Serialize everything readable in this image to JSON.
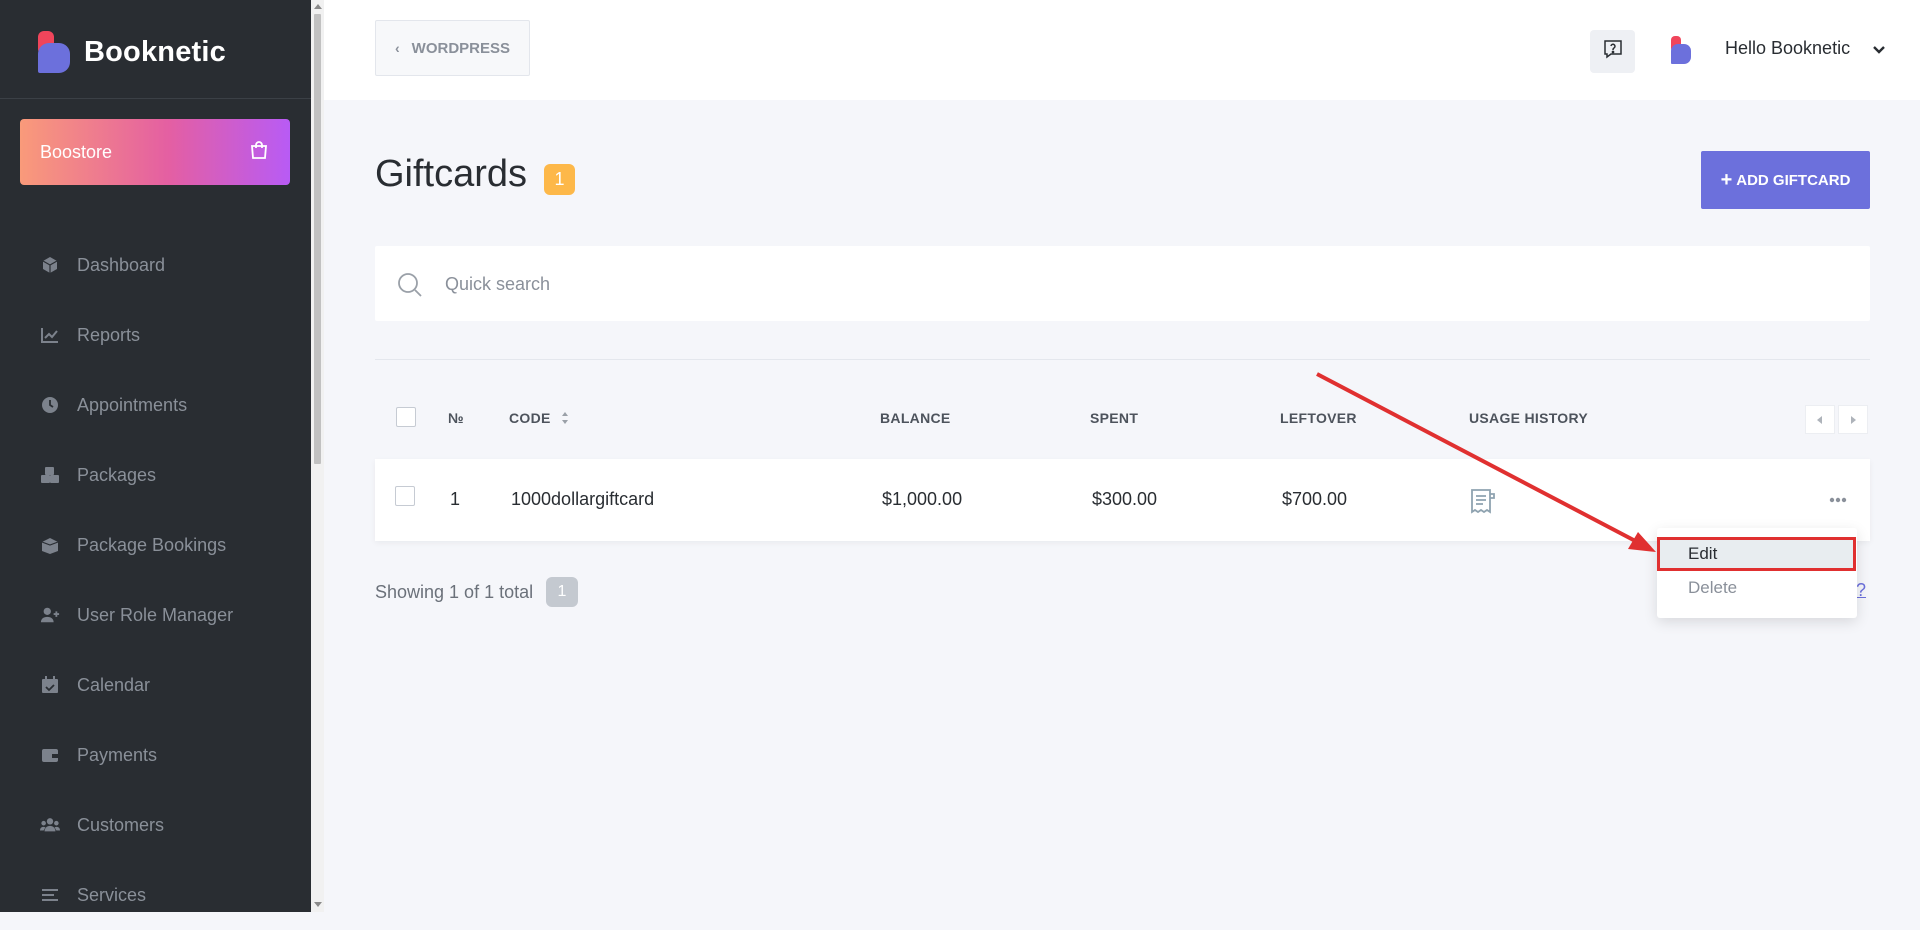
{
  "brand": {
    "name": "Booknetic"
  },
  "boostore": {
    "label": "Boostore",
    "icon": "shopping-bag-icon"
  },
  "sidebar": {
    "items": [
      {
        "label": "Dashboard",
        "icon": "cube-icon"
      },
      {
        "label": "Reports",
        "icon": "chart-line-icon"
      },
      {
        "label": "Appointments",
        "icon": "clock-icon"
      },
      {
        "label": "Packages",
        "icon": "boxes-icon"
      },
      {
        "label": "Package Bookings",
        "icon": "box-open-icon"
      },
      {
        "label": "User Role Manager",
        "icon": "user-plus-icon"
      },
      {
        "label": "Calendar",
        "icon": "calendar-check-icon"
      },
      {
        "label": "Payments",
        "icon": "wallet-icon"
      },
      {
        "label": "Customers",
        "icon": "users-icon"
      },
      {
        "label": "Services",
        "icon": "list-icon"
      }
    ]
  },
  "header": {
    "back_label": "WORDPRESS",
    "greeting": "Hello Booknetic"
  },
  "page": {
    "title": "Giftcards",
    "count": "1",
    "add_label": "ADD GIFTCARD"
  },
  "search": {
    "placeholder": "Quick search"
  },
  "table": {
    "columns": {
      "no": "№",
      "code": "CODE",
      "balance": "BALANCE",
      "spent": "SPENT",
      "leftover": "LEFTOVER",
      "usage": "USAGE HISTORY"
    },
    "rows": [
      {
        "no": "1",
        "code": "1000dollargiftcard",
        "balance": "$1,000.00",
        "spent": "$300.00",
        "leftover": "$700.00"
      }
    ]
  },
  "footer": {
    "showing": "Showing 1 of 1 total",
    "total": "1",
    "partial": "?"
  },
  "menu": {
    "edit": "Edit",
    "delete": "Delete"
  },
  "colors": {
    "sidebar_bg": "#292d32",
    "accent": "#6c70dc",
    "badge": "#fdb849",
    "annotation": "#e03030"
  }
}
